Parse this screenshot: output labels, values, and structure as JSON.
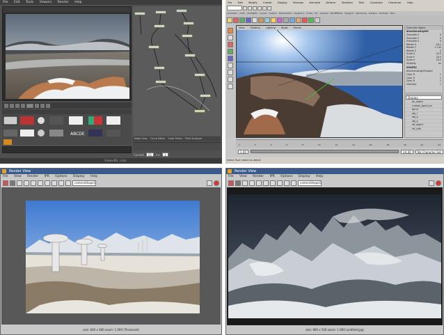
{
  "shake": {
    "menu": [
      "File",
      "Edit",
      "Tools",
      "Viewers",
      "Render",
      "Help"
    ],
    "status_left": "Node View",
    "tabs": [
      "Curve Editor",
      "Color Picker",
      "Pixel Analyzer"
    ],
    "time_labels": [
      "Current",
      "Inc"
    ],
    "time_values": [
      "51",
      "1"
    ],
    "footer": "ViewerBG: color"
  },
  "maya": {
    "menu": [
      "File",
      "Edit",
      "Modify",
      "Create",
      "Display",
      "Window",
      "Animate",
      "Deform",
      "Skeleton",
      "Skin",
      "Constrain",
      "Character",
      "Help"
    ],
    "shelf_tabs": [
      "Animation",
      "Cloth",
      "Cloth&Efx",
      "Curves",
      "Custom",
      "Deformation",
      "Dynamics",
      "Fluids",
      "Fur",
      "General",
      "PaintEffects",
      "Polygons",
      "Rendering",
      "Subdivs",
      "Surfaces",
      "Toon"
    ],
    "panel_menu": [
      "View",
      "Shading",
      "Lighting",
      "Show",
      "Panels"
    ],
    "channel_header": "Channels  Object",
    "node_name": "directionalLight2",
    "channels": [
      {
        "name": "Translate X",
        "value": "0"
      },
      {
        "name": "Translate Y",
        "value": "0"
      },
      {
        "name": "Translate Z",
        "value": "0"
      },
      {
        "name": "Rotate X",
        "value": "-18.2"
      },
      {
        "name": "Rotate Y",
        "value": "1.145"
      },
      {
        "name": "Rotate Z",
        "value": "0"
      },
      {
        "name": "Scale X",
        "value": "20.5"
      },
      {
        "name": "Scale Y",
        "value": "20.5"
      },
      {
        "name": "Scale Z",
        "value": "20.5"
      },
      {
        "name": "Visibility",
        "value": "on"
      }
    ],
    "shapes_header": "SHAPES",
    "shape_name": "directionalLightShape2",
    "shape_channels": [
      {
        "name": "Color R",
        "value": "1"
      },
      {
        "name": "Color G",
        "value": "1"
      },
      {
        "name": "Color B",
        "value": "1"
      },
      {
        "name": "Intensity",
        "value": "1"
      }
    ],
    "layer_mode": "Display",
    "layers": [
      "bk_object",
      "custom_bgrnd_ex",
      "fgrnd",
      "obj_l",
      "obj_p",
      "obj_e",
      "ref_object",
      "ref_side"
    ],
    "frame_ticks": [
      "1",
      "2",
      "4",
      "6",
      "8",
      "10",
      "12",
      "14",
      "16",
      "18",
      "20",
      "22",
      "24"
    ],
    "current_frame": "1.00",
    "range_start": "1.00",
    "range_end": "24.00",
    "character_set": "No Character Set",
    "help_line": "Select Tool: select an object"
  },
  "render_left": {
    "title": "Render View",
    "menu": [
      "File",
      "View",
      "Render",
      "IPR",
      "Options",
      "Display",
      "Help"
    ],
    "camera": "cameraShape1",
    "status": "size: 640 x 480 zoom: 1.000 (Tricolored)"
  },
  "render_right": {
    "title": "Render View",
    "menu": [
      "File",
      "View",
      "Render",
      "IPR",
      "Options",
      "Display",
      "Help"
    ],
    "camera": "cameraShape1",
    "status": "size: 960 x 540 zoom: 1.000 (untitled.jpg)"
  }
}
